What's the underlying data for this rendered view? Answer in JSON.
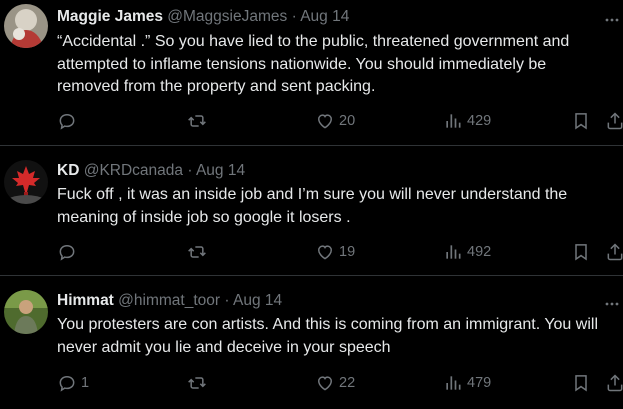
{
  "tweets": [
    {
      "name": "Maggie James",
      "handle": "@MaggsieJames",
      "sep": "·",
      "date": "Aug 14",
      "text": "“Accidental .” So you have lied to the public, threatened government and attempted to inflame tensions nationwide. You should immediately be removed from the property and sent packing.",
      "replies": "",
      "retweets": "",
      "likes": "20",
      "views": "429"
    },
    {
      "name": "KD",
      "handle": "@KRDcanada",
      "sep": "·",
      "date": "Aug 14",
      "text": "Fuck off , it was an inside job and I’m sure you will never understand the meaning of inside job so google it losers .",
      "replies": "",
      "retweets": "",
      "likes": "19",
      "views": "492"
    },
    {
      "name": "Himmat",
      "handle": "@himmat_toor",
      "sep": "·",
      "date": "Aug 14",
      "text": "You protesters are con artists. And this is coming from an immigrant. You will never admit you lie and deceive in your speech",
      "replies": "1",
      "retweets": "",
      "likes": "22",
      "views": "479"
    }
  ],
  "colors": {
    "background": "#000000",
    "text": "#e7e9ea",
    "muted": "#71767b",
    "divider": "#2f3336"
  },
  "icons": {
    "more": "more-icon",
    "reply": "reply-icon",
    "retweet": "retweet-icon",
    "like": "heart-icon",
    "views": "views-icon",
    "bookmark": "bookmark-icon",
    "share": "share-icon"
  }
}
